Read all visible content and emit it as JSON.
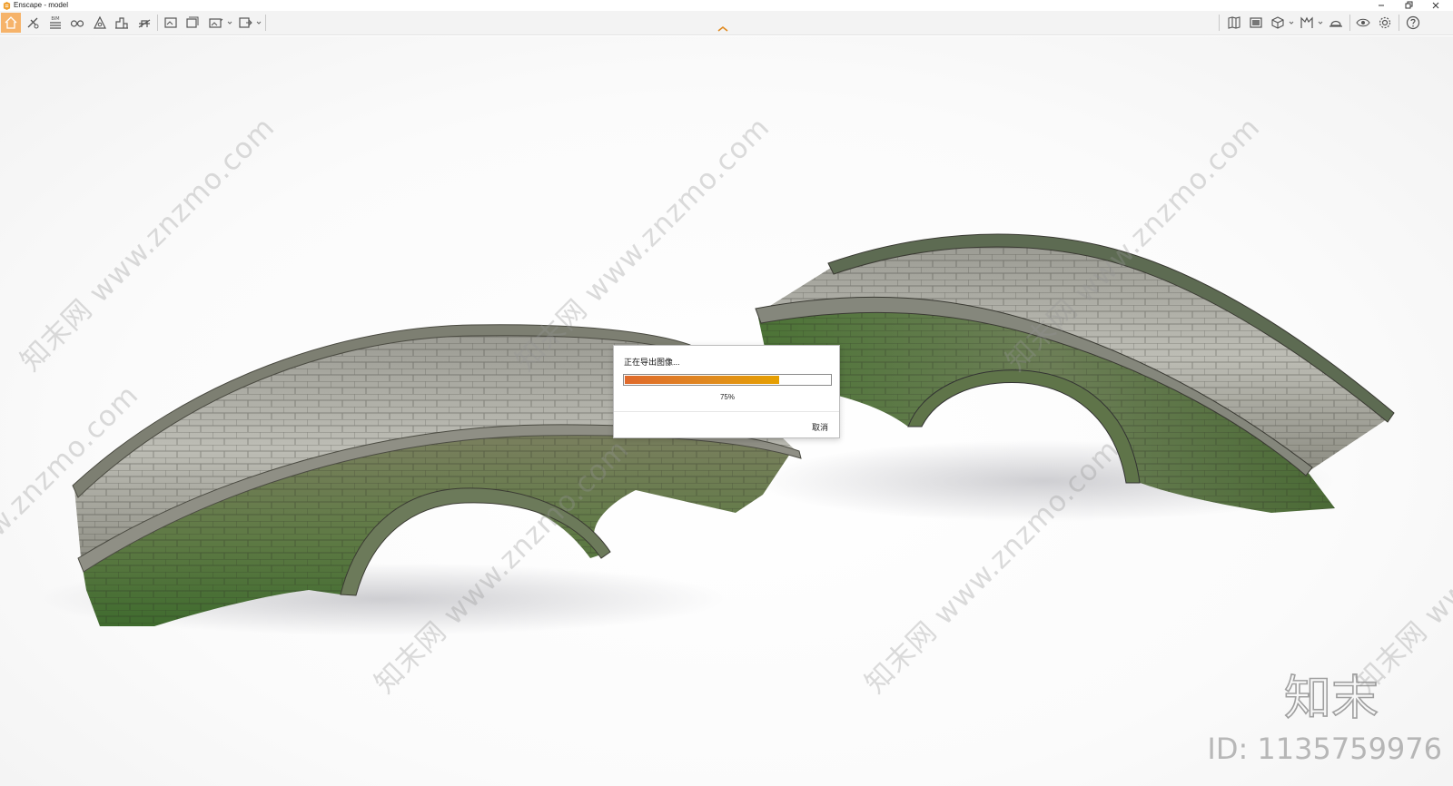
{
  "window": {
    "title": "Enscape - model"
  },
  "toolbar": {
    "left_icons": [
      "home-icon",
      "walk-icon",
      "bim-icon",
      "binoculars-icon",
      "perspective-icon",
      "building-icon",
      "section-icon",
      "screenshot-icon",
      "batch-render-icon",
      "panorama-icon",
      "export-icon"
    ],
    "bim_label": "BIM",
    "right_icons": [
      "map-icon",
      "asset-library-icon",
      "box-icon",
      "material-icon",
      "hat-icon",
      "visual-settings-icon",
      "settings-icon",
      "help-icon"
    ]
  },
  "dialog": {
    "title": "正在导出图像...",
    "progress": 0.75,
    "progress_text": "75%",
    "cancel_label": "取消"
  },
  "watermark": {
    "diagonal_text": "知末网 www.znzmo.com",
    "brand_text": "知末",
    "id_text": "ID: 1135759976"
  },
  "colors": {
    "accent": "#f6b36a",
    "progress_start": "#e06a2c",
    "progress_end": "#e6a000"
  }
}
